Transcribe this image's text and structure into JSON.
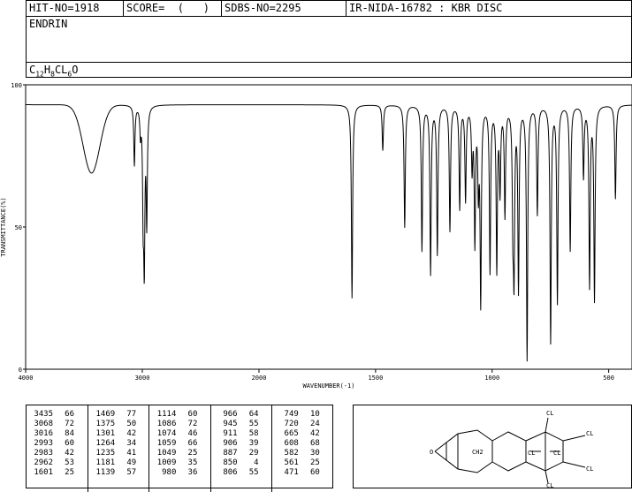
{
  "header": {
    "hit_no": "HIT-NO=1918",
    "score": "SCORE=  (   )",
    "sdbs_no": "SDBS-NO=2295",
    "ir_nida": "IR-NIDA-16782 : KBR DISC",
    "compound": "ENDRIN",
    "formula_parts": [
      "C",
      "12",
      "H",
      "8",
      "CL",
      "6",
      "O"
    ]
  },
  "chart_data": {
    "type": "line",
    "title": "",
    "xlabel": "WAVENUMBER(-1)",
    "ylabel": "TRANSMITTANCE(%)",
    "xlim": [
      4000,
      400
    ],
    "ylim": [
      0,
      100
    ],
    "x_ticks": [
      4000,
      3000,
      2000,
      1500,
      1000,
      500
    ],
    "y_ticks": [
      0,
      50,
      100
    ],
    "grid": false,
    "baseline": 93,
    "broad_bands": [
      {
        "center": 3435,
        "min": 69,
        "width": 150
      }
    ],
    "peaks": [
      {
        "wavenumber": 3435,
        "transmittance": 66
      },
      {
        "wavenumber": 3068,
        "transmittance": 72
      },
      {
        "wavenumber": 3016,
        "transmittance": 84
      },
      {
        "wavenumber": 2993,
        "transmittance": 60
      },
      {
        "wavenumber": 2983,
        "transmittance": 42
      },
      {
        "wavenumber": 2962,
        "transmittance": 53
      },
      {
        "wavenumber": 1601,
        "transmittance": 25
      },
      {
        "wavenumber": 1469,
        "transmittance": 77
      },
      {
        "wavenumber": 1375,
        "transmittance": 50
      },
      {
        "wavenumber": 1301,
        "transmittance": 42
      },
      {
        "wavenumber": 1264,
        "transmittance": 34
      },
      {
        "wavenumber": 1235,
        "transmittance": 41
      },
      {
        "wavenumber": 1181,
        "transmittance": 49
      },
      {
        "wavenumber": 1139,
        "transmittance": 57
      },
      {
        "wavenumber": 1114,
        "transmittance": 60
      },
      {
        "wavenumber": 1086,
        "transmittance": 72
      },
      {
        "wavenumber": 1074,
        "transmittance": 46
      },
      {
        "wavenumber": 1059,
        "transmittance": 66
      },
      {
        "wavenumber": 1049,
        "transmittance": 25
      },
      {
        "wavenumber": 1009,
        "transmittance": 35
      },
      {
        "wavenumber": 980,
        "transmittance": 36
      },
      {
        "wavenumber": 966,
        "transmittance": 64
      },
      {
        "wavenumber": 945,
        "transmittance": 55
      },
      {
        "wavenumber": 911,
        "transmittance": 58
      },
      {
        "wavenumber": 906,
        "transmittance": 39
      },
      {
        "wavenumber": 887,
        "transmittance": 29
      },
      {
        "wavenumber": 850,
        "transmittance": 4
      },
      {
        "wavenumber": 806,
        "transmittance": 55
      },
      {
        "wavenumber": 749,
        "transmittance": 10
      },
      {
        "wavenumber": 720,
        "transmittance": 24
      },
      {
        "wavenumber": 665,
        "transmittance": 42
      },
      {
        "wavenumber": 608,
        "transmittance": 68
      },
      {
        "wavenumber": 582,
        "transmittance": 30
      },
      {
        "wavenumber": 561,
        "transmittance": 25
      },
      {
        "wavenumber": 471,
        "transmittance": 60
      }
    ]
  },
  "structure": {
    "labels": [
      "CL",
      "CL",
      "CL",
      "CL",
      "CL",
      "CL",
      "CH2",
      "O"
    ],
    "line_color": "#000000"
  }
}
